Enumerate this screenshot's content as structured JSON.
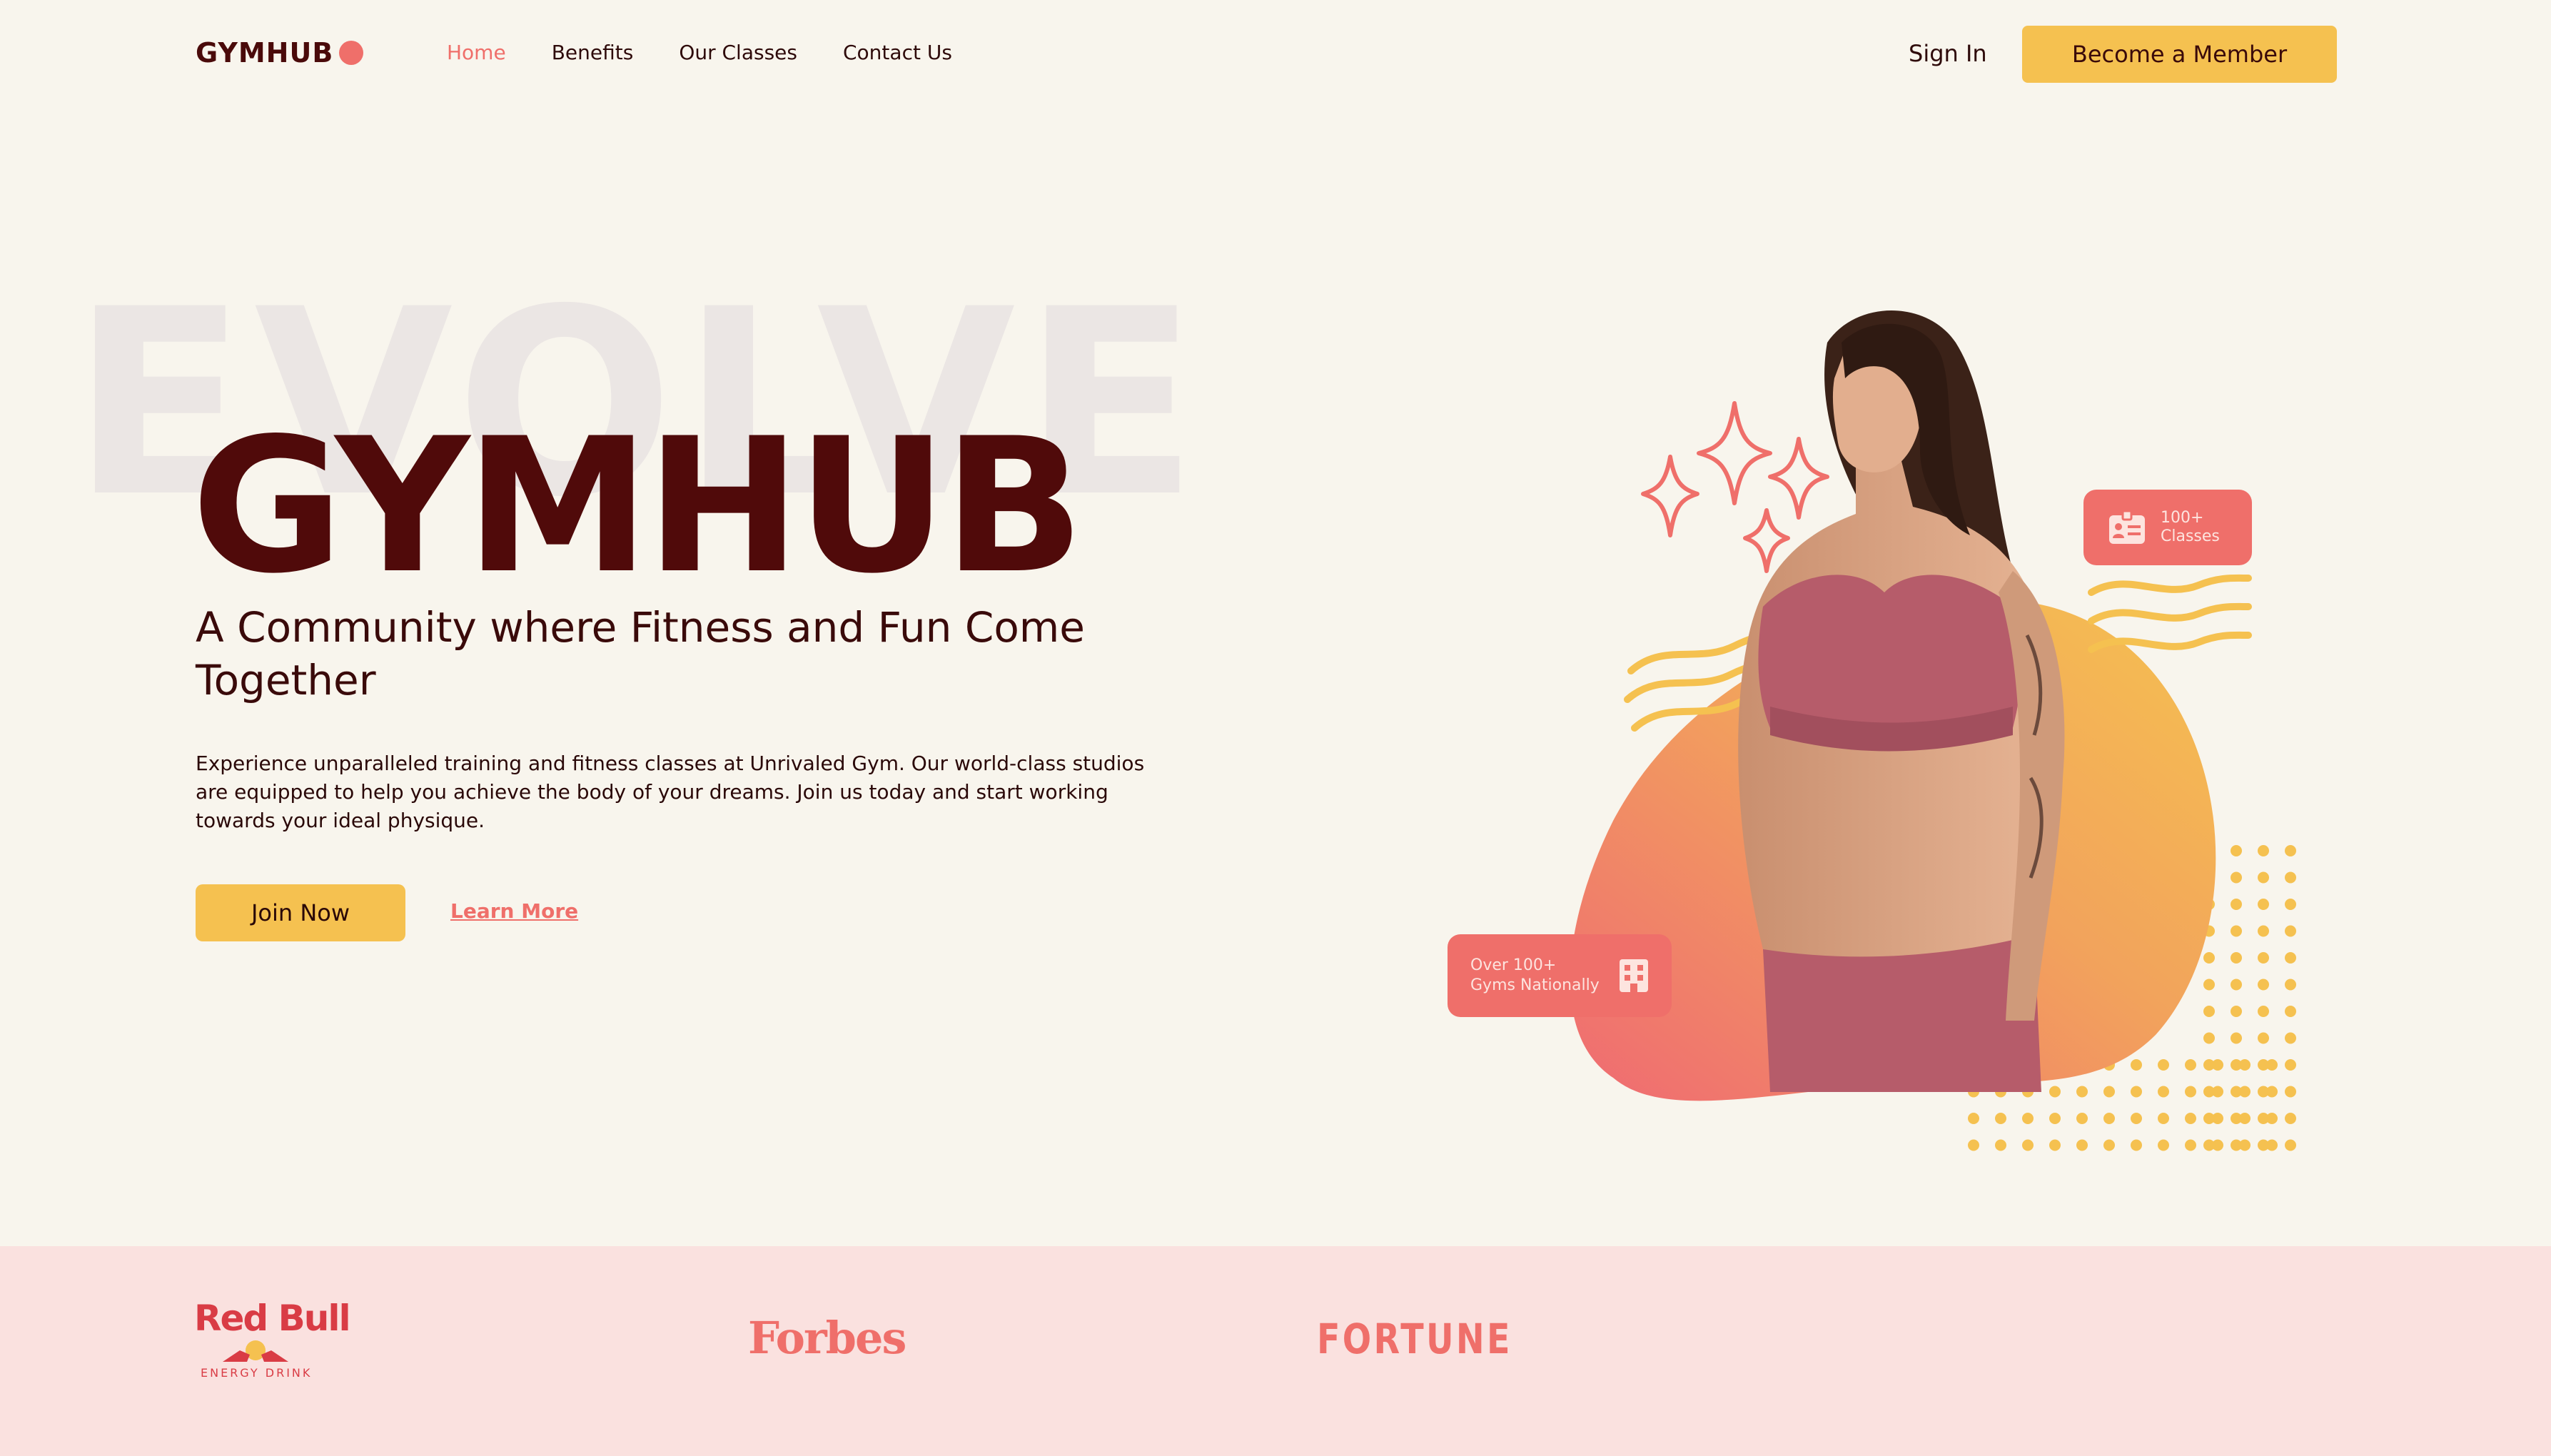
{
  "brand": {
    "name": "GYMHUB",
    "accent": "#ef6f6a",
    "yellow": "#f5c150",
    "dark": "#500a0a"
  },
  "nav": {
    "links": [
      "Home",
      "Benefits",
      "Our Classes",
      "Contact Us"
    ],
    "active": "Home",
    "sign_in": "Sign In",
    "cta": "Become a Member"
  },
  "hero": {
    "background_word": "EVOLVE",
    "title": "GYMHUB",
    "subtitle": "A Community where Fitness and Fun Come Together",
    "description": "Experience unparalleled training and fitness classes at Unrivaled Gym. Our world-class studios are equipped to help you achieve the body of your dreams. Join us today and start working towards your ideal physique.",
    "join_button": "Join Now",
    "learn_more": "Learn More"
  },
  "badges": {
    "classes": {
      "line1": "100+",
      "line2": "Classes",
      "icon": "id-card-icon"
    },
    "gyms": {
      "line1": "Over 100+",
      "line2": "Gyms Nationally",
      "icon": "building-icon"
    }
  },
  "partners": {
    "redbull": {
      "name": "Red Bull",
      "tagline": "ENERGY DRINK"
    },
    "forbes": "Forbes",
    "fortune": "FORTUNE"
  }
}
